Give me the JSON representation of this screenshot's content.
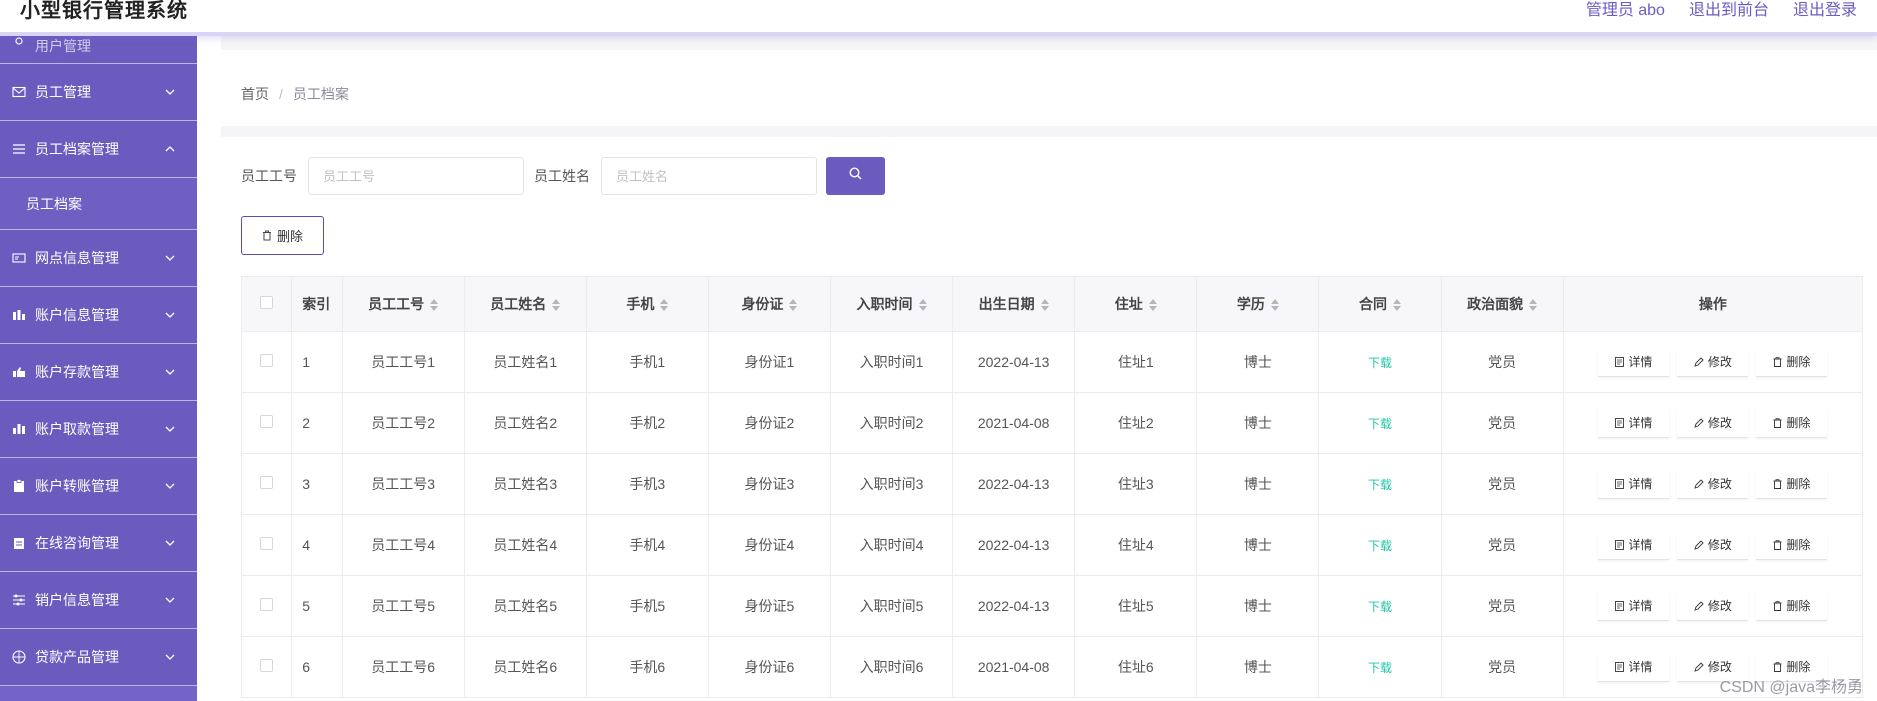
{
  "header": {
    "title": "小型银行管理系统",
    "admin_label": "管理员 abo",
    "back_to_front": "退出到前台",
    "logout": "退出登录"
  },
  "sidebar": {
    "partial_item": "用户管理",
    "items": [
      {
        "label": "员工管理",
        "icon": "mail-icon",
        "expanded": false
      },
      {
        "label": "员工档案管理",
        "icon": "list-icon",
        "expanded": true
      },
      {
        "label": "网点信息管理",
        "icon": "card-icon",
        "expanded": false
      },
      {
        "label": "账户信息管理",
        "icon": "bar-chart-icon",
        "expanded": false
      },
      {
        "label": "账户存款管理",
        "icon": "thumb-icon",
        "expanded": false
      },
      {
        "label": "账户取款管理",
        "icon": "bar-chart-icon",
        "expanded": false
      },
      {
        "label": "账户转账管理",
        "icon": "clipboard-icon",
        "expanded": false
      },
      {
        "label": "在线咨询管理",
        "icon": "clipboard-icon",
        "expanded": false
      },
      {
        "label": "销户信息管理",
        "icon": "sliders-icon",
        "expanded": false
      },
      {
        "label": "贷款产品管理",
        "icon": "globe-icon",
        "expanded": false
      }
    ],
    "subitem": "员工档案"
  },
  "breadcrumb": {
    "home": "首页",
    "separator": "/",
    "current": "员工档案"
  },
  "search": {
    "emp_no_label": "员工工号",
    "emp_no_placeholder": "员工工号",
    "emp_no_value": "",
    "emp_name_label": "员工姓名",
    "emp_name_placeholder": "员工姓名",
    "emp_name_value": ""
  },
  "toolbar": {
    "delete_label": "删除"
  },
  "table": {
    "columns": [
      "索引",
      "员工工号",
      "员工姓名",
      "手机",
      "身份证",
      "入职时间",
      "出生日期",
      "住址",
      "学历",
      "合同",
      "政治面貌",
      "操作"
    ],
    "rows": [
      {
        "index": "1",
        "emp_no": "员工工号1",
        "name": "员工姓名1",
        "phone": "手机1",
        "id_card": "身份证1",
        "hire": "入职时间1",
        "birth": "2022-04-13",
        "address": "住址1",
        "edu": "博士",
        "contract": "下载",
        "politics": "党员"
      },
      {
        "index": "2",
        "emp_no": "员工工号2",
        "name": "员工姓名2",
        "phone": "手机2",
        "id_card": "身份证2",
        "hire": "入职时间2",
        "birth": "2021-04-08",
        "address": "住址2",
        "edu": "博士",
        "contract": "下载",
        "politics": "党员"
      },
      {
        "index": "3",
        "emp_no": "员工工号3",
        "name": "员工姓名3",
        "phone": "手机3",
        "id_card": "身份证3",
        "hire": "入职时间3",
        "birth": "2022-04-13",
        "address": "住址3",
        "edu": "博士",
        "contract": "下载",
        "politics": "党员"
      },
      {
        "index": "4",
        "emp_no": "员工工号4",
        "name": "员工姓名4",
        "phone": "手机4",
        "id_card": "身份证4",
        "hire": "入职时间4",
        "birth": "2022-04-13",
        "address": "住址4",
        "edu": "博士",
        "contract": "下载",
        "politics": "党员"
      },
      {
        "index": "5",
        "emp_no": "员工工号5",
        "name": "员工姓名5",
        "phone": "手机5",
        "id_card": "身份证5",
        "hire": "入职时间5",
        "birth": "2022-04-13",
        "address": "住址5",
        "edu": "博士",
        "contract": "下载",
        "politics": "党员"
      },
      {
        "index": "6",
        "emp_no": "员工工号6",
        "name": "员工姓名6",
        "phone": "手机6",
        "id_card": "身份证6",
        "hire": "入职时间6",
        "birth": "2021-04-08",
        "address": "住址6",
        "edu": "博士",
        "contract": "下载",
        "politics": "党员"
      }
    ],
    "actions": {
      "detail": "详情",
      "edit": "修改",
      "delete": "删除"
    }
  },
  "watermark": "CSDN @java李杨勇",
  "colors": {
    "primary": "#6b5bbe",
    "sidebar": "#6c5bbf",
    "download_link": "#21c6a8"
  }
}
